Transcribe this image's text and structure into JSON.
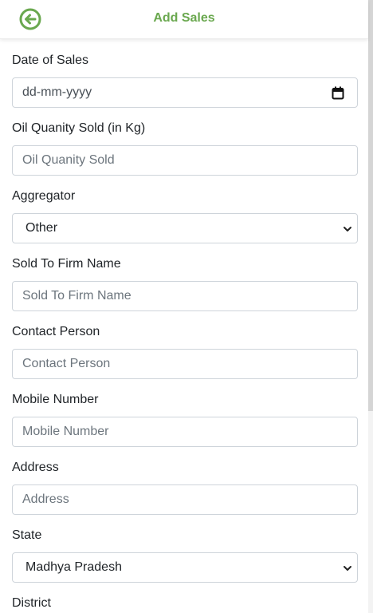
{
  "header": {
    "title": "Add Sales",
    "back_icon": "arrow-left-circle-icon",
    "accent_color": "#6aa84f"
  },
  "form": {
    "date_of_sales": {
      "label": "Date of Sales",
      "placeholder": "dd-mm-yyyy"
    },
    "oil_quantity": {
      "label": "Oil Quanity Sold (in Kg)",
      "placeholder": "Oil Quanity Sold"
    },
    "aggregator": {
      "label": "Aggregator",
      "value": "Other"
    },
    "firm_name": {
      "label": "Sold To Firm Name",
      "placeholder": "Sold To Firm Name"
    },
    "contact_person": {
      "label": "Contact Person",
      "placeholder": "Contact Person"
    },
    "mobile": {
      "label": "Mobile Number",
      "placeholder": "Mobile Number"
    },
    "address": {
      "label": "Address",
      "placeholder": "Address"
    },
    "state": {
      "label": "State",
      "value": "Madhya Pradesh"
    },
    "district": {
      "label": "District"
    }
  }
}
